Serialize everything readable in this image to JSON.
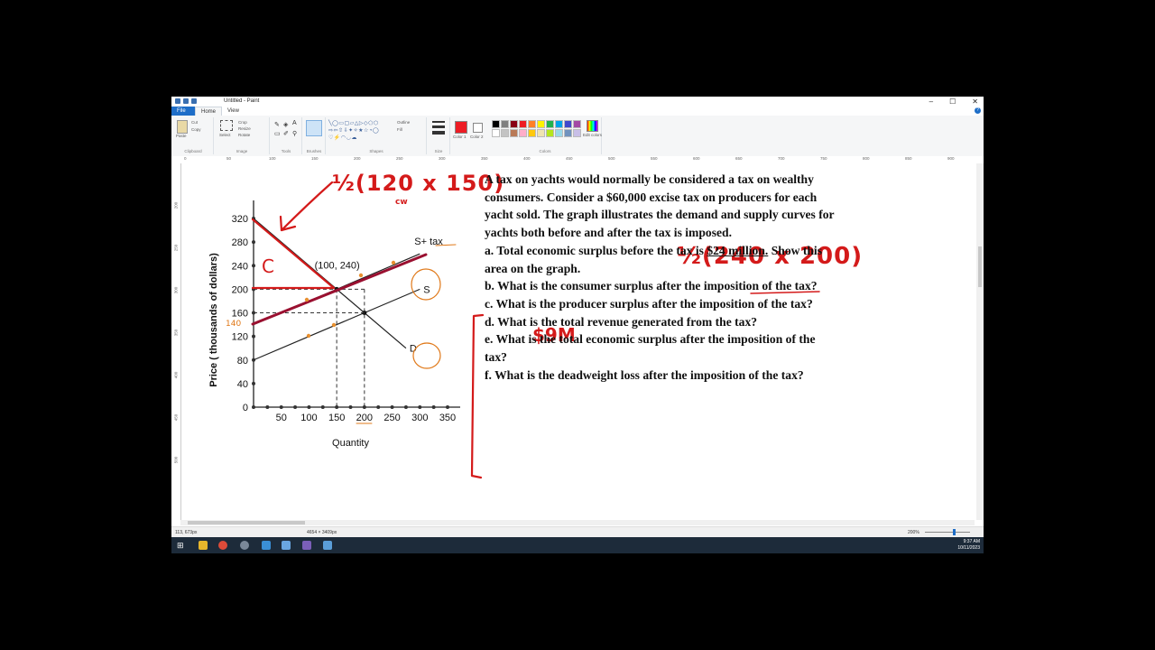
{
  "window": {
    "title": "Untitled - Paint",
    "controls": [
      "–",
      "☐",
      "✕"
    ]
  },
  "ribbon_tabs": [
    "File",
    "Home",
    "View"
  ],
  "ribbon": {
    "clipboard": {
      "label": "Clipboard",
      "paste": "Paste",
      "cut": "Cut",
      "copy": "Copy"
    },
    "image": {
      "label": "Image",
      "select": "Select",
      "crop": "Crop",
      "resize": "Resize",
      "rotate": "Rotate"
    },
    "tools": {
      "label": "Tools"
    },
    "brushes": {
      "label": "Brushes"
    },
    "shapes": {
      "label": "Shapes",
      "outline": "Outline",
      "fill": "Fill"
    },
    "size": {
      "label": "Size"
    },
    "color1": {
      "label": "Color 1"
    },
    "color2": {
      "label": "Color 2"
    },
    "colors": {
      "label": "Colors",
      "edit": "Edit colors"
    },
    "palette": [
      "#000000",
      "#7f7f7f",
      "#880015",
      "#ed1c24",
      "#ff7f27",
      "#fff200",
      "#22b14c",
      "#00a2e8",
      "#3f48cc",
      "#a349a4",
      "#ffffff",
      "#c3c3c3",
      "#b97a57",
      "#ffaec9",
      "#ffc90e",
      "#efe4b0",
      "#b5e61d",
      "#99d9ea",
      "#7092be",
      "#c8bfe7"
    ]
  },
  "ruler_ticks": [
    "0",
    "50",
    "100",
    "150",
    "200",
    "250",
    "300",
    "350",
    "400",
    "450",
    "500",
    "550",
    "600",
    "650",
    "700",
    "750",
    "800",
    "850",
    "900"
  ],
  "vruler_ticks": [
    "200",
    "250",
    "300",
    "350",
    "400",
    "450",
    "500"
  ],
  "problem": {
    "intro": "A tax on yachts would normally be considered a tax on wealthy consumers. Consider a $60,000 excise tax on producers for each yacht sold. The graph illustrates the demand and supply curves for yachts both before and after the tax is imposed.",
    "a_before": "a. Total economic surplus before the tax is ",
    "a_value": "$24 million.",
    "a_after": " Show this area on the graph.",
    "b": "b. What is the consumer surplus after the imposition of the tax?",
    "c": "c. What is the producer surplus after the imposition of the tax?",
    "d": "d. What is the total revenue generated from the tax?",
    "e": "e. What is the total economic surplus after the imposition of the tax?",
    "f": "f. What is the deadweight loss after the imposition of the tax?"
  },
  "chart_data": {
    "type": "line",
    "title": "",
    "xlabel": "Quantity",
    "ylabel": "Price ( thousands of dollars)",
    "xlim": [
      0,
      350
    ],
    "ylim": [
      0,
      320
    ],
    "x_ticks": [
      "50",
      "100",
      "150",
      "200",
      "250",
      "300",
      "350"
    ],
    "y_ticks": [
      "0",
      "40",
      "80",
      "120",
      "160",
      "200",
      "240",
      "280",
      "320"
    ],
    "series": [
      {
        "name": "D",
        "points": [
          [
            0,
            320
          ],
          [
            150,
            200
          ],
          [
            275,
            100
          ]
        ]
      },
      {
        "name": "S",
        "points": [
          [
            0,
            80
          ],
          [
            200,
            160
          ],
          [
            300,
            200
          ]
        ]
      },
      {
        "name": "S+ tax",
        "points": [
          [
            0,
            140
          ],
          [
            150,
            200
          ],
          [
            300,
            260
          ]
        ]
      }
    ],
    "annotation": "(100, 240)",
    "dashed_levels": [
      160,
      200
    ],
    "dashed_quantities": [
      150,
      200
    ]
  },
  "annotations": {
    "top_formula": "½(120 x 150)",
    "top_sub": "cw",
    "right_formula": "½(240 x 200)",
    "cs_label": "C",
    "price_140": "140",
    "answer_b": "$9M"
  },
  "status": {
    "cursor": "113, 673px",
    "size": "4654 × 3409px",
    "zoom": "200%"
  },
  "taskbar": {
    "time": "9:37 AM",
    "date": "10/11/2023"
  }
}
